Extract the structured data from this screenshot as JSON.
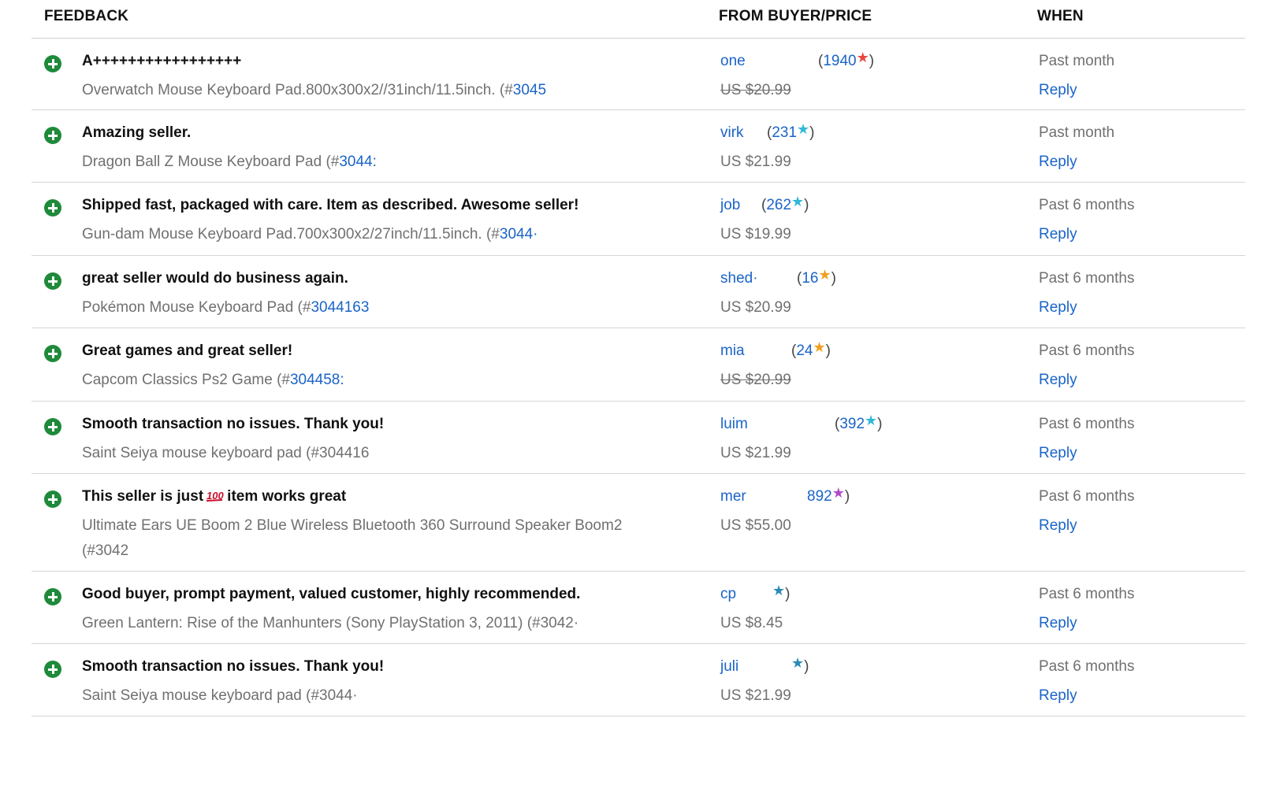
{
  "columns": {
    "feedback": "FEEDBACK",
    "from": "FROM BUYER/PRICE",
    "when": "WHEN"
  },
  "rows": [
    {
      "comment": "A+++++++++++++++++",
      "item_text": "Overwatch Mouse Keyboard Pad.800x300x2//31inch/11.5inch. (#",
      "item_link": "3045",
      "buyer": "one",
      "score_open": "(",
      "score": "1940",
      "score_close": ")",
      "star_color": "#e8453c",
      "price": "US $20.99",
      "price_struck": true,
      "when": "Past month",
      "reply": "Reply"
    },
    {
      "comment": "Amazing seller.",
      "item_text": "Dragon Ball Z Mouse Keyboard Pad (#",
      "item_link": "3044:",
      "buyer": "virk",
      "score_open": "(",
      "score": "231",
      "score_close": ")",
      "star_color": "#2fb8d8",
      "price": "US $21.99",
      "price_struck": false,
      "when": "Past month",
      "reply": "Reply"
    },
    {
      "comment": "Shipped fast, packaged with care. Item as described. Awesome seller!",
      "item_text": "Gun-dam Mouse Keyboard Pad.700x300x2/27inch/11.5inch. (#",
      "item_link": "3044·",
      "buyer": "job",
      "score_open": "(",
      "score": "262",
      "score_close": ")",
      "star_color": "#2fb8d8",
      "price": "US $19.99",
      "price_struck": false,
      "when": "Past 6 months",
      "reply": "Reply"
    },
    {
      "comment": "great seller would do business again.",
      "item_text": "Pokémon Mouse Keyboard Pad (#",
      "item_link": "3044163",
      "buyer": "shed·",
      "score_open": "(",
      "score": "16",
      "score_close": ")",
      "star_color": "#f0a020",
      "price": "US $20.99",
      "price_struck": false,
      "when": "Past 6 months",
      "reply": "Reply"
    },
    {
      "comment": "Great games and great seller!",
      "item_text": "Capcom Classics Ps2 Game (#",
      "item_link": "304458:",
      "buyer": "mia",
      "score_open": "(",
      "score": "24",
      "score_close": ")",
      "star_color": "#f0a020",
      "price": "US $20.99",
      "price_struck": true,
      "when": "Past 6 months",
      "reply": "Reply"
    },
    {
      "comment": "Smooth transaction no issues. Thank you!",
      "item_text": "Saint Seiya mouse keyboard pad (#304416",
      "item_link": "",
      "buyer": "luim",
      "score_open": "(",
      "score": "392",
      "score_close": ")",
      "star_color": "#2fb8d8",
      "price": "US $21.99",
      "price_struck": false,
      "when": "Past 6 months",
      "reply": "Reply"
    },
    {
      "comment_pre": "This seller is just",
      "comment_post": "item works great",
      "emoji": "hundred-points-icon",
      "item_text": "Ultimate Ears UE Boom 2 Blue Wireless Bluetooth 360 Surround Speaker Boom2 (#3042",
      "item_link": "",
      "buyer": "mer",
      "score_open": "",
      "score": "892",
      "score_close": ")",
      "star_color": "#b04ac8",
      "price": "US $55.00",
      "price_struck": false,
      "when": "Past 6 months",
      "reply": "Reply"
    },
    {
      "comment": "Good buyer, prompt payment, valued customer, highly recommended.",
      "item_text": "Green Lantern: Rise of the Manhunters (Sony PlayStation 3, 2011) (#3042·",
      "item_link": "",
      "buyer": "cp",
      "score_open": "",
      "score": "",
      "score_close": ")",
      "star_color": "#2a8ab8",
      "price": "US $8.45",
      "price_struck": false,
      "when": "Past 6 months",
      "reply": "Reply"
    },
    {
      "comment": "Smooth transaction no issues. Thank you!",
      "item_text": "Saint Seiya mouse keyboard pad (#3044·",
      "item_link": "",
      "buyer": "juli",
      "score_open": "",
      "score": "",
      "score_close": ")",
      "star_color": "#2a8ab8",
      "price": "US $21.99",
      "price_struck": false,
      "when": "Past 6 months",
      "reply": "Reply"
    }
  ]
}
